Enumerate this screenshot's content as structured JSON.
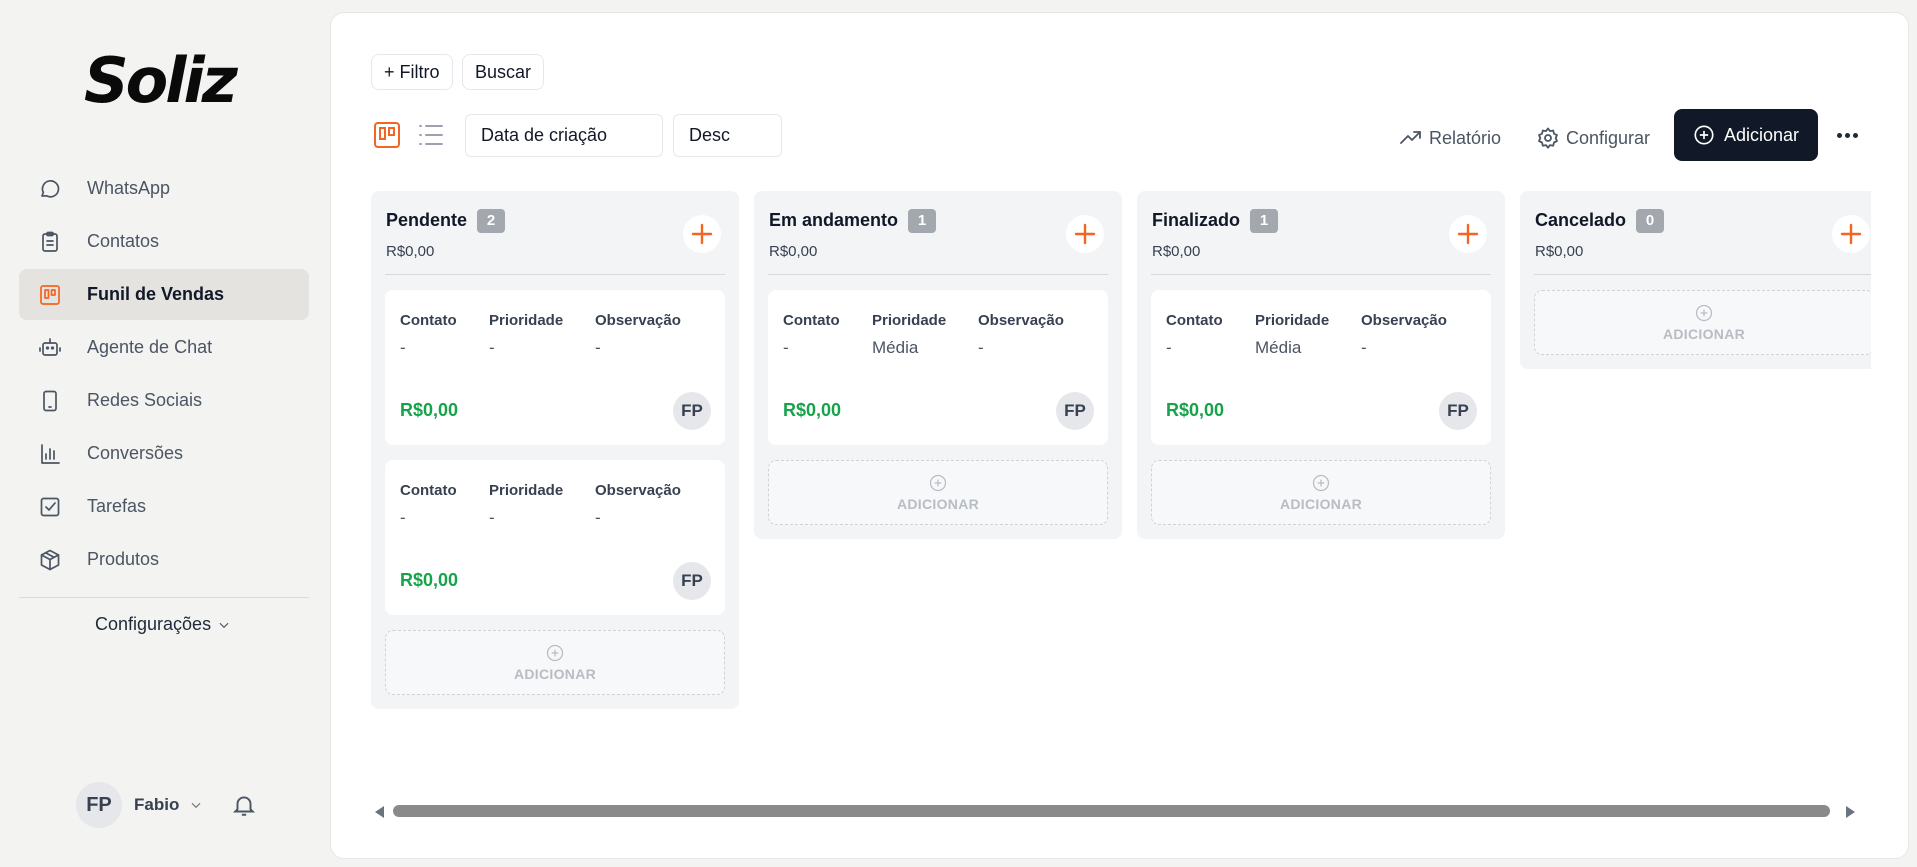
{
  "brand": {
    "logo": "Soliz",
    "accent": "#f26522"
  },
  "sidebar": {
    "items": [
      {
        "label": "WhatsApp",
        "icon": "chat-bubble-icon"
      },
      {
        "label": "Contatos",
        "icon": "clipboard-icon"
      },
      {
        "label": "Funil de Vendas",
        "icon": "kanban-icon",
        "active": true
      },
      {
        "label": "Agente de Chat",
        "icon": "robot-icon"
      },
      {
        "label": "Redes Sociais",
        "icon": "phone-icon"
      },
      {
        "label": "Conversões",
        "icon": "bar-chart-icon"
      },
      {
        "label": "Tarefas",
        "icon": "checkbox-icon"
      },
      {
        "label": "Produtos",
        "icon": "package-icon"
      }
    ],
    "settings_label": "Configurações",
    "user": {
      "initials": "FP",
      "name": "Fabio"
    }
  },
  "toolbar": {
    "filter_label": "+ Filtro",
    "search_label": "Buscar",
    "sort_field": "Data de criação",
    "sort_order": "Desc",
    "report_label": "Relatório",
    "configure_label": "Configurar",
    "add_label": "Adicionar"
  },
  "board": {
    "field_labels": {
      "contact": "Contato",
      "priority": "Prioridade",
      "note": "Observação"
    },
    "add_slot_label": "ADICIONAR",
    "columns": [
      {
        "title": "Pendente",
        "count": "2",
        "total": "R$0,00",
        "cards": [
          {
            "contact": "-",
            "priority": "-",
            "note": "-",
            "price": "R$0,00",
            "owner": "FP"
          },
          {
            "contact": "-",
            "priority": "-",
            "note": "-",
            "price": "R$0,00",
            "owner": "FP"
          }
        ]
      },
      {
        "title": "Em andamento",
        "count": "1",
        "total": "R$0,00",
        "cards": [
          {
            "contact": "-",
            "priority": "Média",
            "note": "-",
            "price": "R$0,00",
            "owner": "FP"
          }
        ]
      },
      {
        "title": "Finalizado",
        "count": "1",
        "total": "R$0,00",
        "cards": [
          {
            "contact": "-",
            "priority": "Média",
            "note": "-",
            "price": "R$0,00",
            "owner": "FP"
          }
        ]
      },
      {
        "title": "Cancelado",
        "count": "0",
        "total": "R$0,00",
        "cards": []
      }
    ]
  }
}
